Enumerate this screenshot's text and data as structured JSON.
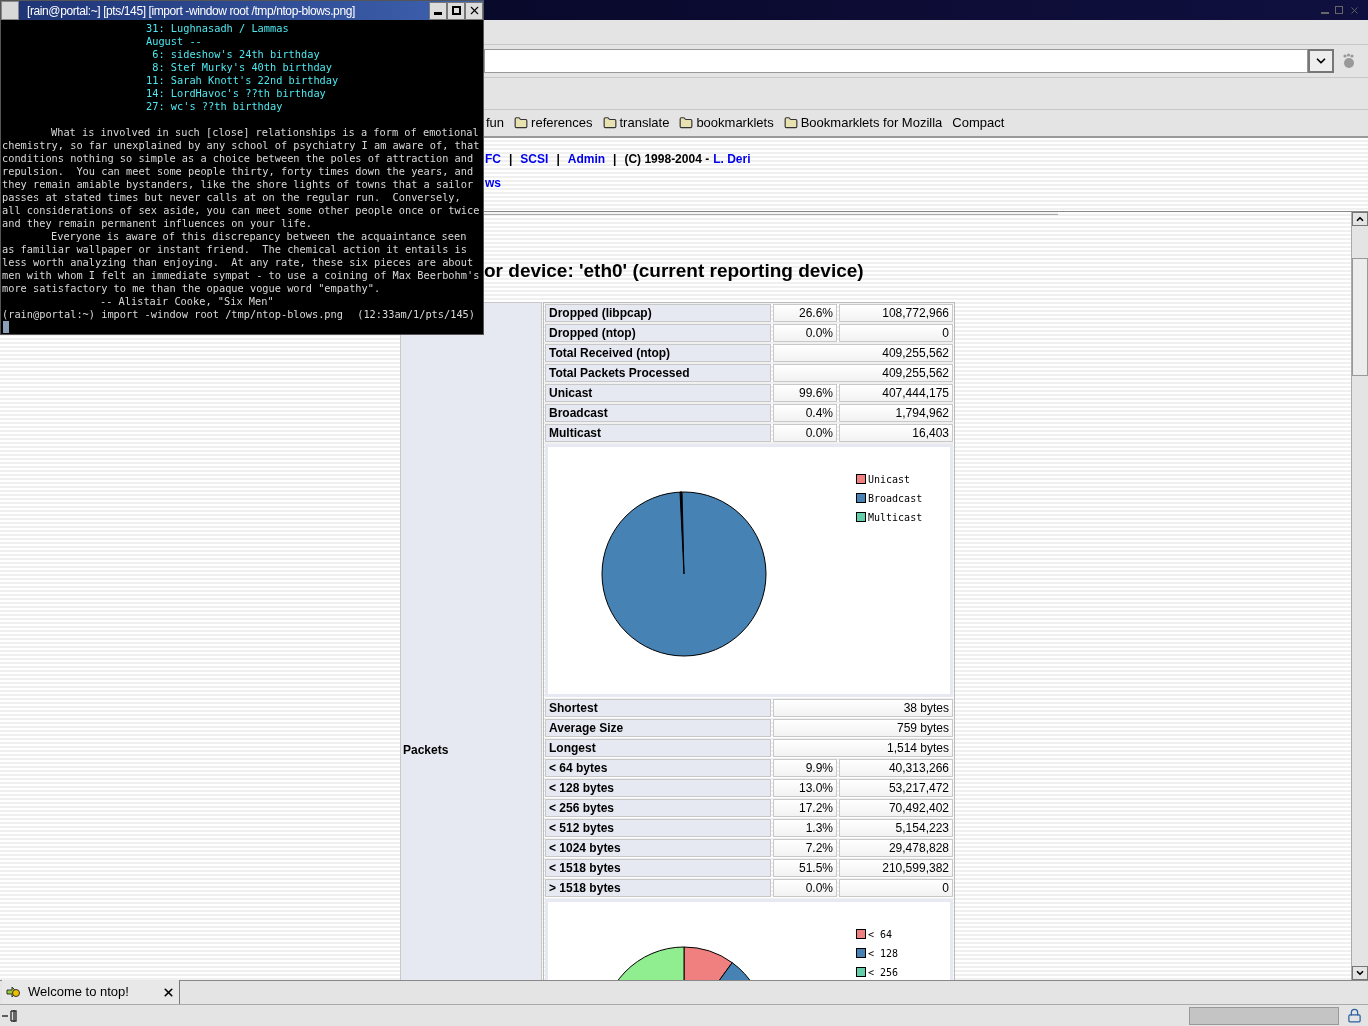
{
  "terminal": {
    "title": "[rain@portal:~] [pts/145] [import -window root /tmp/ntop-blows.png]",
    "lines": [
      {
        "kind": "calendar",
        "text": "31: Lughnasadh / Lammas"
      },
      {
        "kind": "calendar",
        "text": "August --"
      },
      {
        "kind": "calendar",
        "text": " 6: sideshow's 24th birthday"
      },
      {
        "kind": "calendar",
        "text": " 8: Stef Murky's 40th birthday"
      },
      {
        "kind": "calendar",
        "text": "11: Sarah Knott's 22nd birthday"
      },
      {
        "kind": "calendar",
        "text": "14: LordHavoc's ??th birthday"
      },
      {
        "kind": "calendar",
        "text": "27: wc's ??th birthday"
      },
      {
        "kind": "para",
        "text": "What is involved in such [close] relationships is a form of emotional"
      },
      {
        "kind": "text",
        "text": "chemistry, so far unexplained by any school of psychiatry I am aware of, that"
      },
      {
        "kind": "text",
        "text": "conditions nothing so simple as a choice between the poles of attraction and"
      },
      {
        "kind": "text",
        "text": "repulsion.  You can meet some people thirty, forty times down the years, and"
      },
      {
        "kind": "text",
        "text": "they remain amiable bystanders, like the shore lights of towns that a sailor"
      },
      {
        "kind": "text",
        "text": "passes at stated times but never calls at on the regular run.  Conversely,"
      },
      {
        "kind": "text",
        "text": "all considerations of sex aside, you can meet some other people once or twice"
      },
      {
        "kind": "text",
        "text": "and they remain permanent influences on your life."
      },
      {
        "kind": "para",
        "text": "Everyone is aware of this discrepancy between the acquaintance seen"
      },
      {
        "kind": "text",
        "text": "as familiar wallpaper or instant friend.  The chemical action it entails is"
      },
      {
        "kind": "text",
        "text": "less worth analyzing than enjoying.  At any rate, these six pieces are about"
      },
      {
        "kind": "text",
        "text": "men with whom I felt an immediate sympat - to use a coining of Max Beerbohm's"
      },
      {
        "kind": "text",
        "text": "more satisfactory to me than the opaque vogue word \"empathy\"."
      },
      {
        "kind": "attribution",
        "text": "-- Alistair Cooke, \"Six Men\""
      }
    ],
    "prompt": "(rain@portal:~) import -window root /tmp/ntop-blows.png",
    "prompt_status": "(12:33am/1/pts/145)"
  },
  "bookmarks": [
    {
      "kind": "text",
      "label": "fun"
    },
    {
      "kind": "folder",
      "label": "references"
    },
    {
      "kind": "folder",
      "label": "translate"
    },
    {
      "kind": "folder",
      "label": "bookmarklets"
    },
    {
      "kind": "folder",
      "label": "Bookmarklets for Mozilla"
    },
    {
      "kind": "text",
      "label": "Compact"
    }
  ],
  "header_links": [
    {
      "kind": "link",
      "text": "FC"
    },
    {
      "kind": "separator",
      "text": "|"
    },
    {
      "kind": "link",
      "text": "SCSI"
    },
    {
      "kind": "separator",
      "text": "|"
    },
    {
      "kind": "link",
      "text": "Admin"
    },
    {
      "kind": "separator",
      "text": "|"
    },
    {
      "kind": "text",
      "text": "(C) 1998-2004 -"
    },
    {
      "kind": "link",
      "text": "L. Deri"
    }
  ],
  "header_line2": "ws",
  "heading": "or device: 'eth0' (current reporting device)",
  "section_label": "Packets",
  "rows": [
    {
      "kind": "split",
      "label": "Dropped (libpcap)",
      "percent": "26.6%",
      "value": "108,772,966"
    },
    {
      "kind": "split",
      "label": "Dropped (ntop)",
      "percent": "0.0%",
      "value": "0"
    },
    {
      "kind": "full",
      "label": "Total Received (ntop)",
      "value": "409,255,562"
    },
    {
      "kind": "full",
      "label": "Total Packets Processed",
      "value": "409,255,562"
    },
    {
      "kind": "split",
      "label": "Unicast",
      "percent": "99.6%",
      "value": "407,444,175"
    },
    {
      "kind": "split",
      "label": "Broadcast",
      "percent": "0.4%",
      "value": "1,794,962"
    },
    {
      "kind": "split",
      "label": "Multicast",
      "percent": "0.0%",
      "value": "16,403"
    },
    {
      "kind": "pie",
      "legend": [
        {
          "label": "Unicast",
          "color": "#f08080"
        },
        {
          "label": "Broadcast",
          "color": "#4682b4"
        },
        {
          "label": "Multicast",
          "color": "#66cdaa"
        }
      ]
    },
    {
      "kind": "full",
      "label": "Shortest",
      "value": "38 bytes"
    },
    {
      "kind": "full",
      "label": "Average Size",
      "value": "759 bytes"
    },
    {
      "kind": "full",
      "label": "Longest",
      "value": "1,514 bytes"
    },
    {
      "kind": "split",
      "label": "< 64 bytes",
      "percent": "9.9%",
      "value": "40,313,266"
    },
    {
      "kind": "split",
      "label": "< 128 bytes",
      "percent": "13.0%",
      "value": "53,217,472"
    },
    {
      "kind": "split",
      "label": "< 256 bytes",
      "percent": "17.2%",
      "value": "70,492,402"
    },
    {
      "kind": "split",
      "label": "< 512 bytes",
      "percent": "1.3%",
      "value": "5,154,223"
    },
    {
      "kind": "split",
      "label": "< 1024 bytes",
      "percent": "7.2%",
      "value": "29,478,828"
    },
    {
      "kind": "split",
      "label": "< 1518 bytes",
      "percent": "51.5%",
      "value": "210,599,382"
    },
    {
      "kind": "split",
      "label": "> 1518 bytes",
      "percent": "0.0%",
      "value": "0"
    },
    {
      "kind": "pie",
      "legend": [
        {
          "label": "< 64",
          "color": "#f08080"
        },
        {
          "label": "< 128",
          "color": "#4682b4"
        },
        {
          "label": "< 256",
          "color": "#66cdaa"
        }
      ]
    }
  ],
  "tabs": [
    {
      "label": "Welcome to ntop!",
      "selected": true
    }
  ],
  "progress": {
    "level": 0
  }
}
